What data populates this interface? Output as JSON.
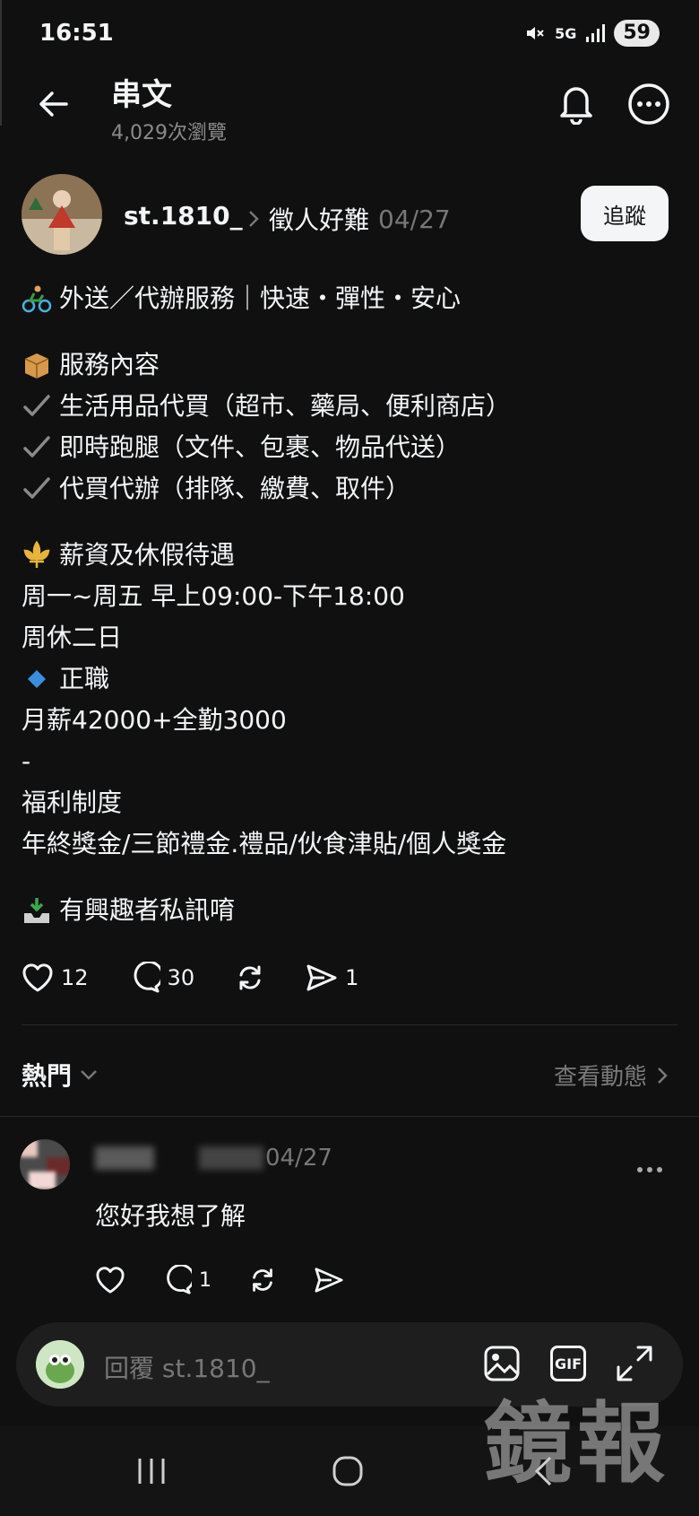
{
  "status_bar": {
    "time": "16:51",
    "network": "5G",
    "battery": "59"
  },
  "header": {
    "title": "串文",
    "views": "4,029次瀏覽"
  },
  "post": {
    "author": "st.1810_",
    "topic": "徵人好難",
    "date": "04/27",
    "follow_label": "追蹤",
    "lines": [
      {
        "emoji": "bike-icon",
        "text": "外送／代辦服務｜快速・彈性・安心"
      },
      {
        "gap": true
      },
      {
        "emoji": "package-icon",
        "text": "服務內容"
      },
      {
        "emoji": "check-icon",
        "text": "生活用品代買（超市、藥局、便利商店）"
      },
      {
        "emoji": "check-icon",
        "text": "即時跑腿（文件、包裹、物品代送）"
      },
      {
        "emoji": "check-icon",
        "text": "代買代辦（排隊、繳費、取件）"
      },
      {
        "gap": true
      },
      {
        "emoji": "fleur-icon",
        "text": "薪資及休假待遇"
      },
      {
        "text": "周一~周五 早上09:00-下午18:00"
      },
      {
        "text": "周休二日"
      },
      {
        "emoji": "diamond-icon",
        "text": "正職"
      },
      {
        "text": "月薪42000+全勤3000"
      },
      {
        "text": "-"
      },
      {
        "text": "福利制度"
      },
      {
        "text": "年終獎金/三節禮金.禮品/伙食津貼/個人獎金"
      },
      {
        "gap": true
      },
      {
        "emoji": "inbox-icon",
        "text": "有興趣者私訊唷"
      }
    ],
    "likes": "12",
    "comments": "30",
    "shares": "1"
  },
  "sort": {
    "label": "熱門",
    "see_activity": "查看動態"
  },
  "comment": {
    "date": "04/27",
    "text": "您好我想了解",
    "replies": "1"
  },
  "reply_box": {
    "placeholder": "回覆 st.1810_",
    "gif_label": "GIF"
  },
  "watermark": "鏡報"
}
